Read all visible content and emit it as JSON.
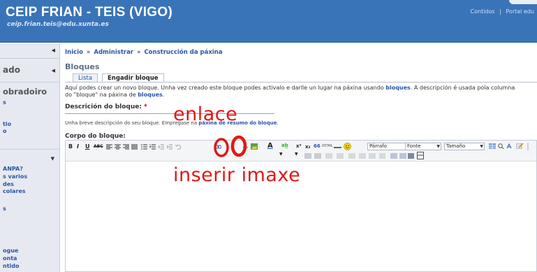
{
  "header": {
    "title": "CEIP FRIAN - TEIS (VIGO)",
    "email": "ceip.frian.teis@edu.xunta.es",
    "links": [
      "Contidos",
      "Portal edu"
    ]
  },
  "sidebar": {
    "rows": [
      {
        "text": ""
      },
      {
        "text": "ado"
      },
      {
        "text": "obradoiro"
      }
    ],
    "links_a": [
      "s",
      "tio",
      "o"
    ],
    "links_b": [
      "ANPA?",
      "s varios",
      "des",
      "colares",
      "",
      "s"
    ],
    "links_c": [
      "ogue",
      "onta",
      "ntido"
    ]
  },
  "main": {
    "breadcrumb": [
      "Inicio",
      "Administrar",
      "Construcción da páxina"
    ],
    "breadcrumb_sep": "»",
    "page_title": "Bloques",
    "tabs": [
      {
        "label": "Lista",
        "active": false
      },
      {
        "label": "Engadir bloque",
        "active": true
      }
    ],
    "intro_part1": "Aquí podes crear un novo bloque. Unha vez creado este bloque podes activalo e darlle un lugar na páxina usando ",
    "intro_link1": "bloques",
    "intro_part2": ". A descripción é usada pola columna",
    "intro_part3": "do \"bloque\" na páxina de ",
    "intro_link2": "bloques",
    "intro_part4": ".",
    "desc_label": "Descrición do bloque:",
    "desc_required": "*",
    "desc_help1": "Unha breve descripción do seu bloque. Empregase na ",
    "desc_help_link": "páxina de resumo do bloque",
    "desc_help2": ".",
    "body_label": "Corpo do bloque:"
  },
  "toolbar": {
    "format_buttons": [
      "B",
      "I",
      "U",
      "ABC"
    ],
    "superscript": "x²",
    "subscript": "x₂",
    "quote": "66",
    "html": "HTML",
    "paragraph_select": "Párrafo",
    "font_select": "Fonte",
    "size_select": "Tamaño"
  },
  "annotations": {
    "link": "enlace",
    "insert_image": "inserir imaxe"
  },
  "colors": {
    "header_bg": "#3a74b8",
    "link": "#2a56a6",
    "annotation": "#e01818",
    "sidebar_bg": "#e6eaf0"
  }
}
